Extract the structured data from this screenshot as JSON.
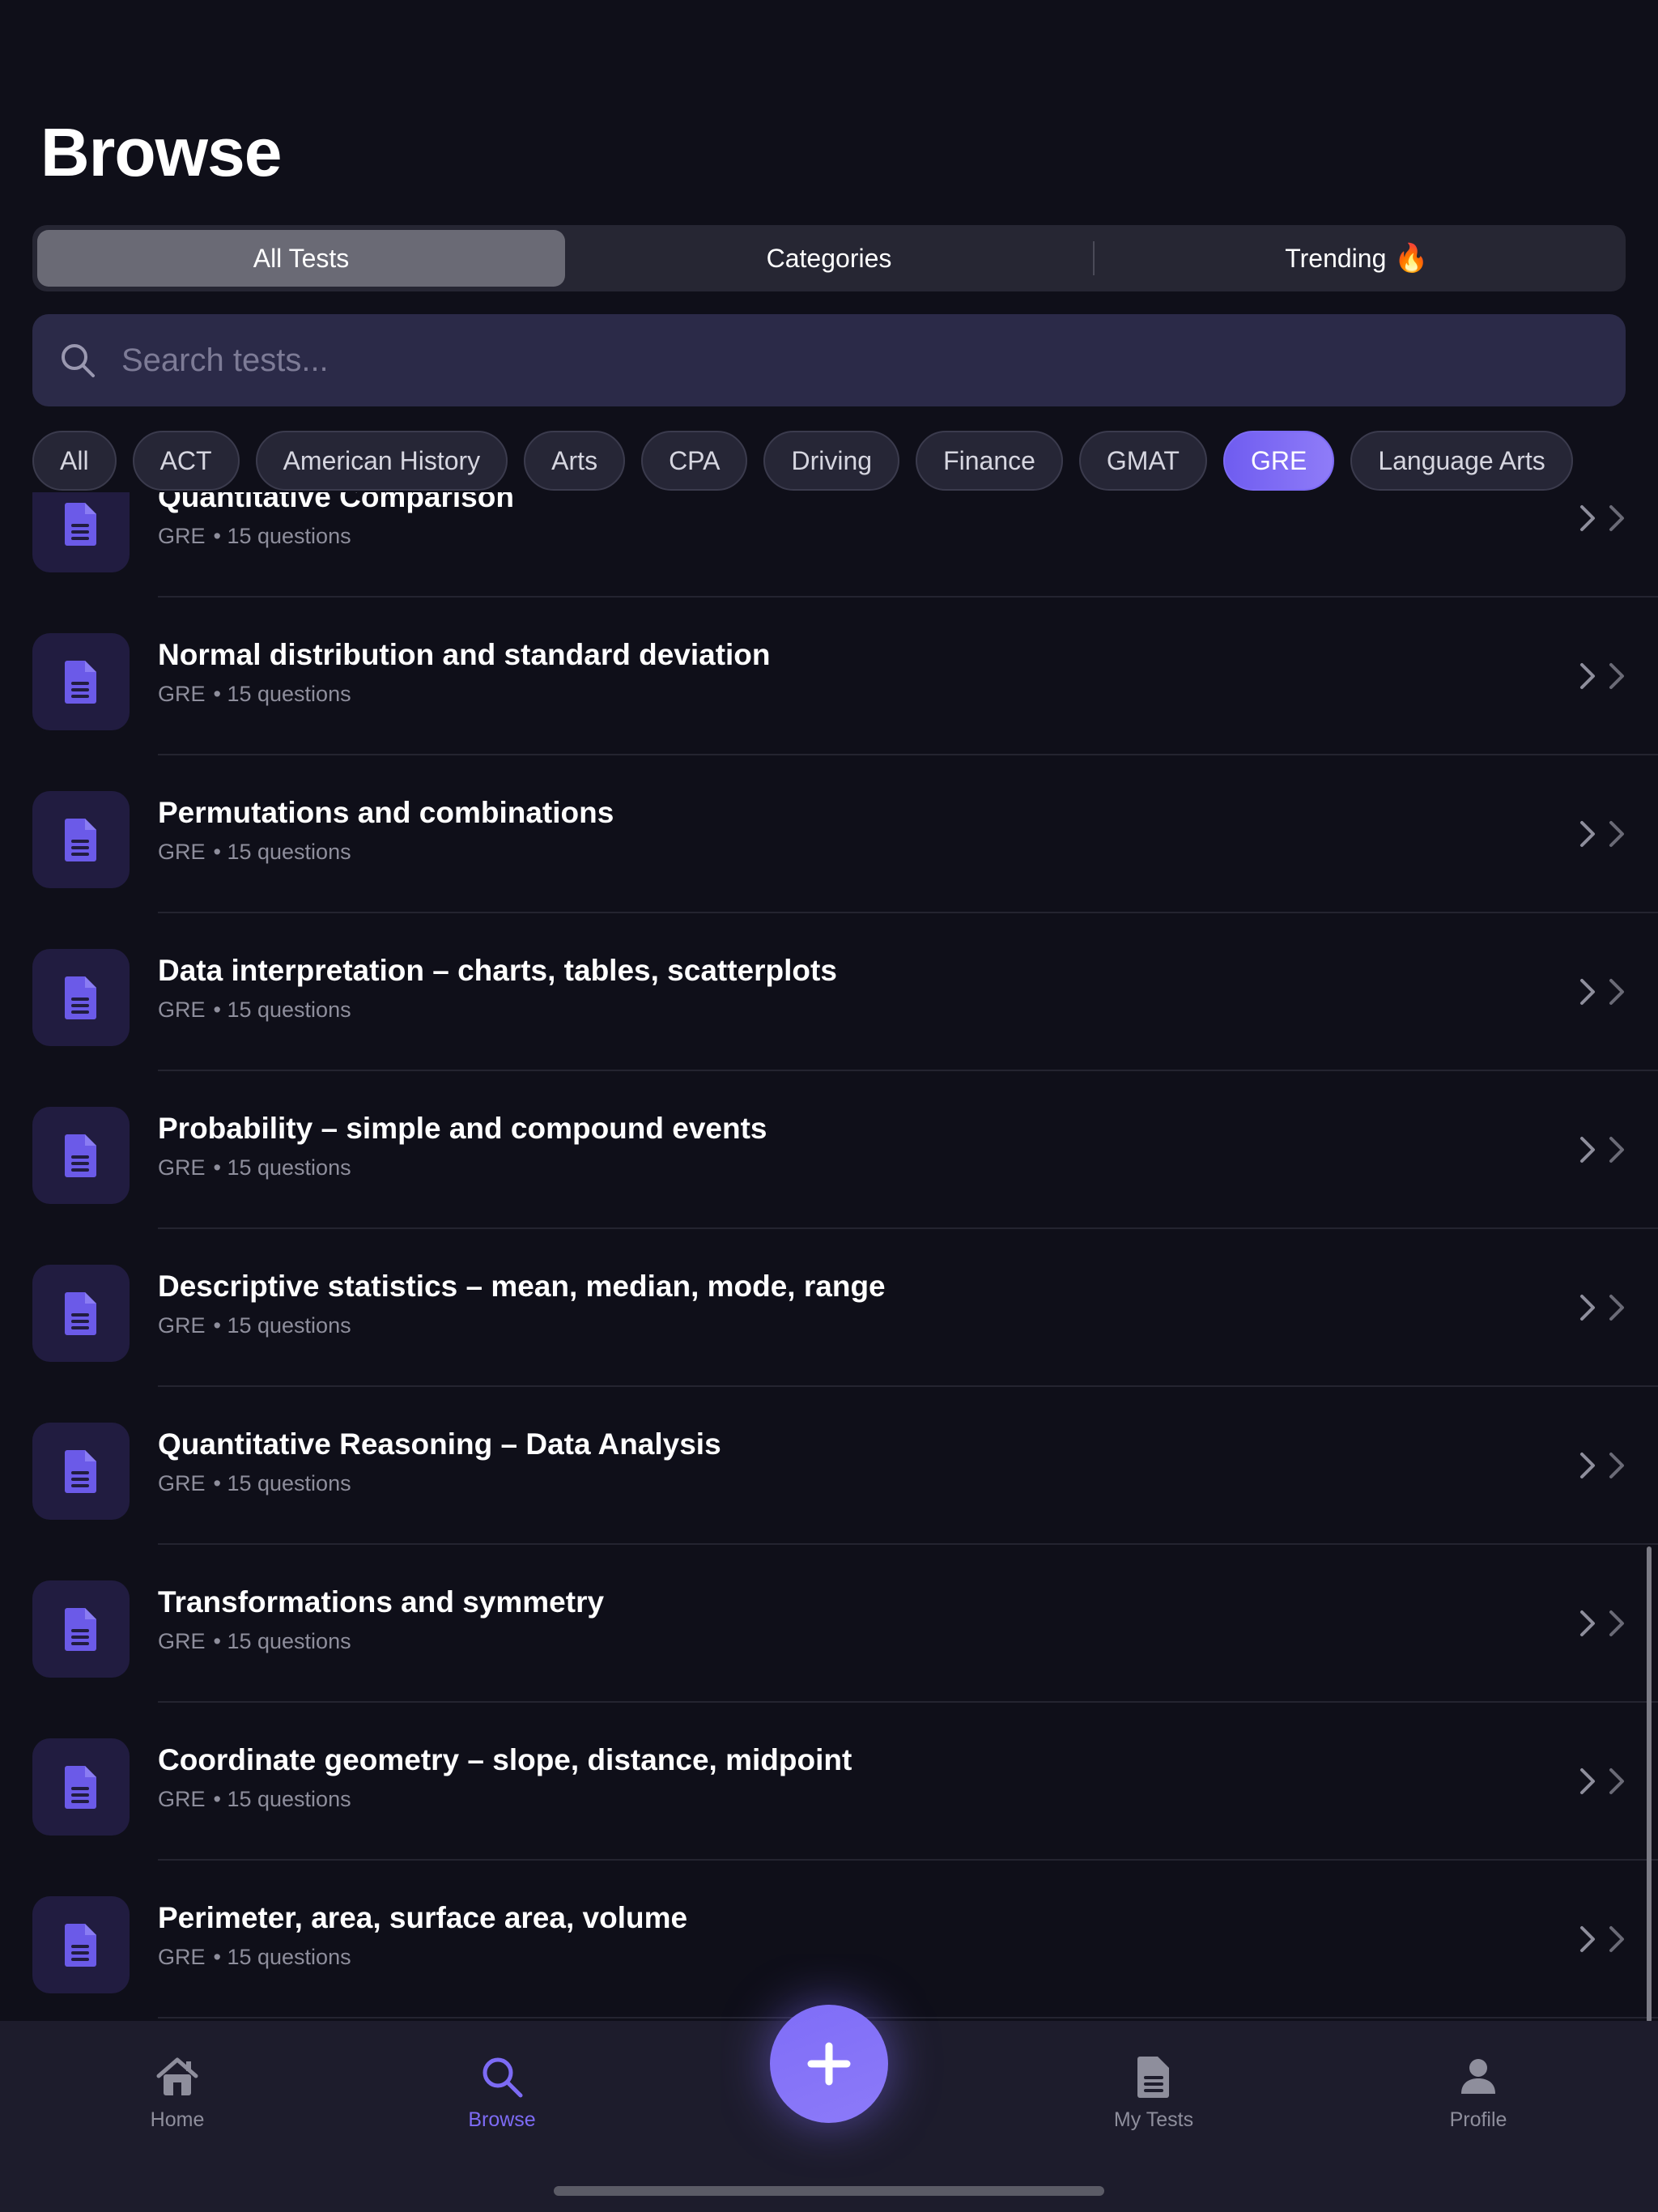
{
  "header": {
    "title": "Browse"
  },
  "segments": [
    {
      "label": "All Tests",
      "active": true
    },
    {
      "label": "Categories",
      "active": false
    },
    {
      "label": "Trending",
      "active": false,
      "emoji": "🔥"
    }
  ],
  "search": {
    "placeholder": "Search tests..."
  },
  "chips": [
    {
      "label": "All",
      "active": false
    },
    {
      "label": "ACT",
      "active": false
    },
    {
      "label": "American History",
      "active": false
    },
    {
      "label": "Arts",
      "active": false
    },
    {
      "label": "CPA",
      "active": false
    },
    {
      "label": "Driving",
      "active": false
    },
    {
      "label": "Finance",
      "active": false
    },
    {
      "label": "GMAT",
      "active": false
    },
    {
      "label": "GRE",
      "active": true
    },
    {
      "label": "Language Arts",
      "active": false
    }
  ],
  "tests": [
    {
      "title": "Quantitative Comparison",
      "category": "GRE",
      "questions": "• 15 questions"
    },
    {
      "title": "Normal distribution and standard deviation",
      "category": "GRE",
      "questions": "• 15 questions"
    },
    {
      "title": "Permutations and combinations",
      "category": "GRE",
      "questions": "• 15 questions"
    },
    {
      "title": "Data interpretation – charts, tables, scatterplots",
      "category": "GRE",
      "questions": "• 15 questions"
    },
    {
      "title": "Probability – simple and compound events",
      "category": "GRE",
      "questions": "• 15 questions"
    },
    {
      "title": "Descriptive statistics – mean, median, mode, range",
      "category": "GRE",
      "questions": "• 15 questions"
    },
    {
      "title": "Quantitative Reasoning – Data Analysis",
      "category": "GRE",
      "questions": "• 15 questions"
    },
    {
      "title": "Transformations and symmetry",
      "category": "GRE",
      "questions": "• 15 questions"
    },
    {
      "title": "Coordinate geometry – slope, distance, midpoint",
      "category": "GRE",
      "questions": "• 15 questions"
    },
    {
      "title": "Perimeter, area, surface area, volume",
      "category": "GRE",
      "questions": "• 15 questions"
    }
  ],
  "tabbar": {
    "home": "Home",
    "browse": "Browse",
    "my_tests": "My Tests",
    "profile": "Profile",
    "active": "browse"
  },
  "colors": {
    "accent": "#7d6bf5",
    "background": "#0f0f19",
    "tabbar": "#1d1c2c"
  }
}
